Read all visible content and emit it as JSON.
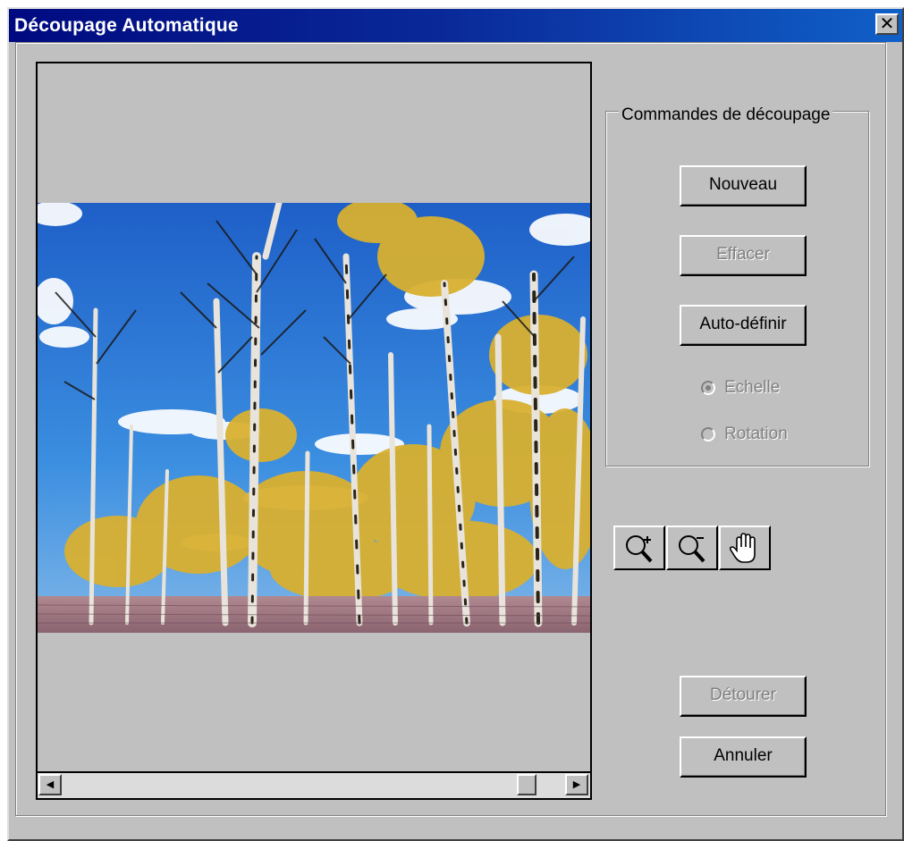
{
  "window": {
    "title": "Découpage Automatique",
    "close_glyph": "✕"
  },
  "preview": {
    "image_subject": "aspen trees against blue sky",
    "scroll_left_glyph": "◀",
    "scroll_right_glyph": "▶"
  },
  "commands": {
    "group_title": "Commandes de découpage",
    "new_label": "Nouveau",
    "erase_label": "Effacer",
    "autodefine_label": "Auto-définir",
    "scale_label": "Echelle",
    "rotation_label": "Rotation",
    "selected_mode": "Echelle"
  },
  "tools": {
    "zoom_in": "zoom-in-icon",
    "zoom_out": "zoom-out-icon",
    "pan": "hand-icon"
  },
  "actions": {
    "crop_label": "Détourer",
    "cancel_label": "Annuler"
  },
  "colors": {
    "title_bar_start": "#000a80",
    "title_bar_end": "#1060c8",
    "face": "#c0c0c0",
    "disabled_text": "#808080"
  }
}
